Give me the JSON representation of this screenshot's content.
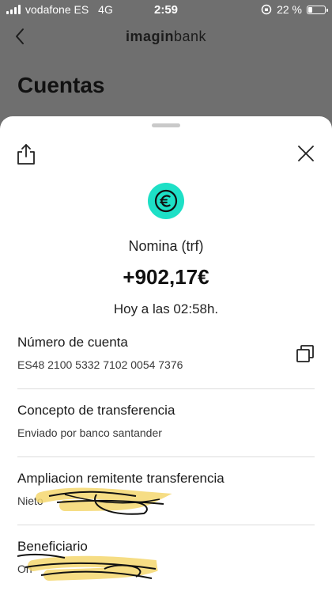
{
  "status": {
    "carrier": "vodafone ES",
    "network": "4G",
    "time": "2:59",
    "battery": "22 %",
    "battery_level": 0.22,
    "signal_bars": 4
  },
  "nav": {
    "back_icon": "chevron-left-icon",
    "brand_light": "imagin",
    "brand_bold": "bank"
  },
  "page": {
    "title": "Cuentas"
  },
  "sheet": {
    "share_icon": "share-icon",
    "close_icon": "close-icon",
    "currency_icon": "euro-coin-icon",
    "accent": "#1de0c6",
    "description": "Nomina (trf)",
    "amount": "+902,17€",
    "date": "Hoy a las 02:58h.",
    "fields": [
      {
        "label": "Número de cuenta",
        "value": "ES48 2100 5332 7102 0054 7376",
        "action_icon": "copy-icon"
      },
      {
        "label": "Concepto de transferencia",
        "value": "Enviado por banco santander"
      },
      {
        "label": "Ampliacion remitente transferencia",
        "value": "Nieto"
      },
      {
        "label": "Beneficiario",
        "value": "On"
      }
    ]
  }
}
